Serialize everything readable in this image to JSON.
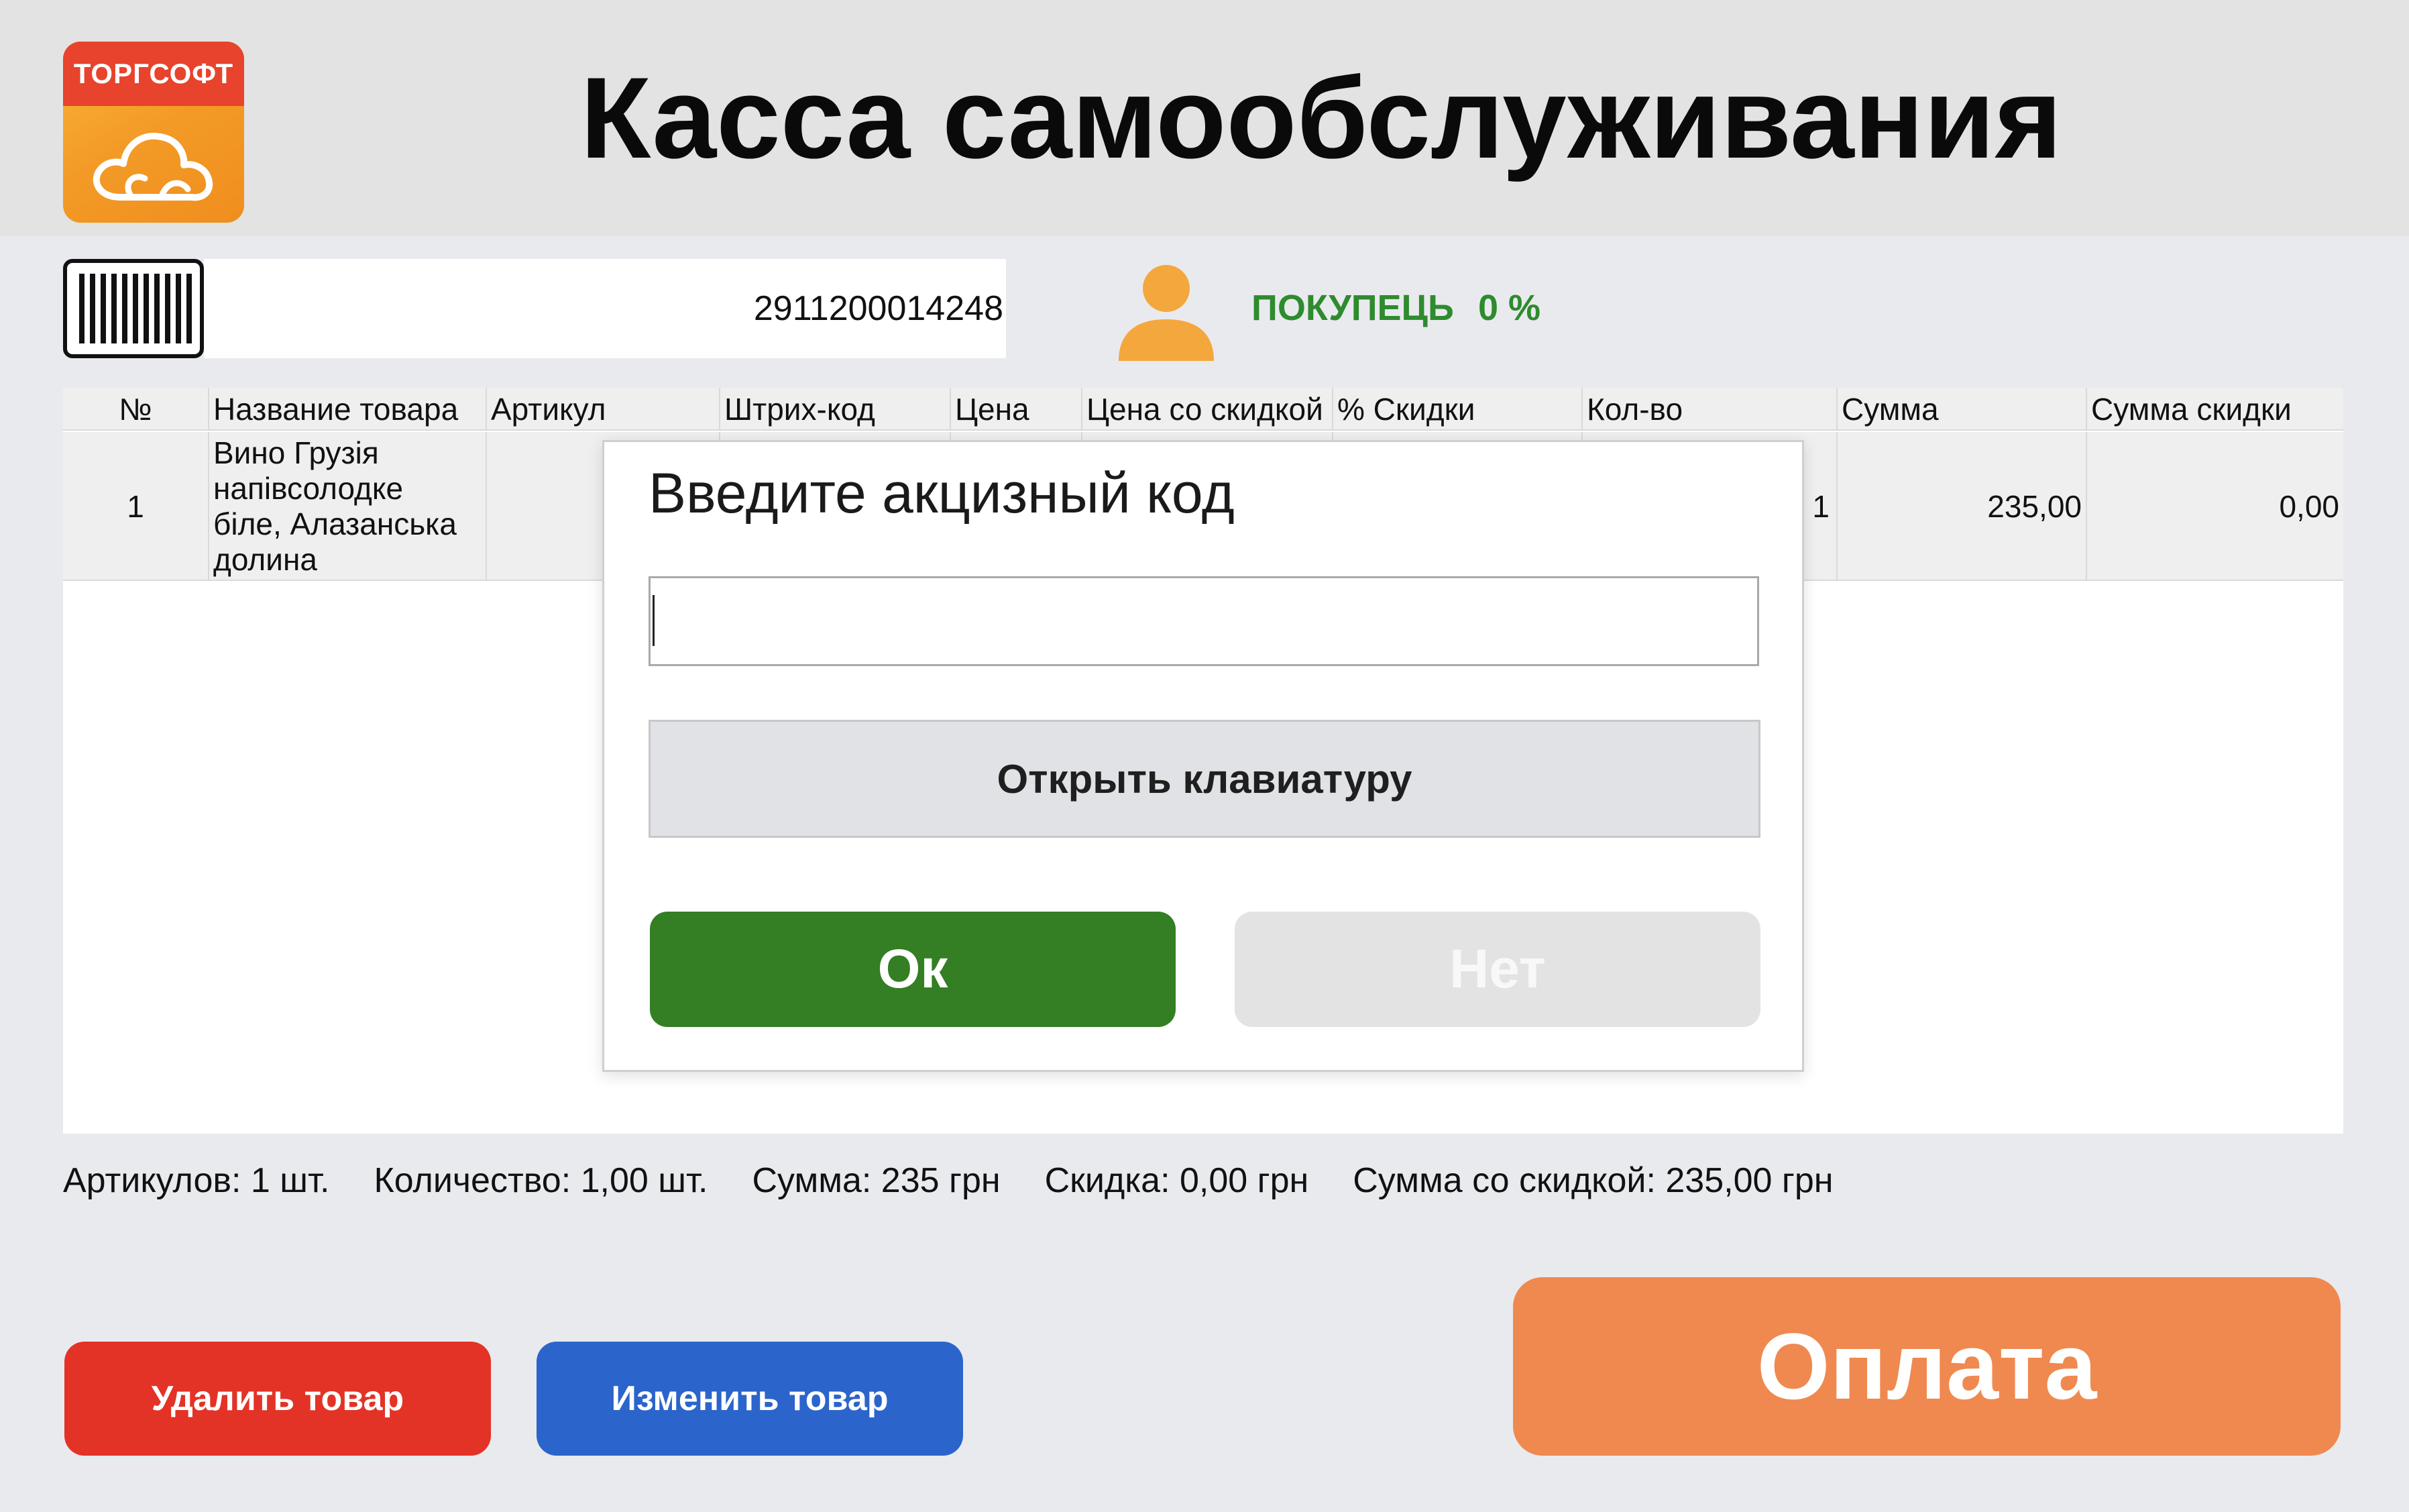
{
  "header": {
    "logo_text": "ТОРГСОФТ",
    "title": "Касса самообслуживания"
  },
  "scan": {
    "barcode_value": "2911200014248",
    "customer_label": "ПОКУПЕЦЬ",
    "customer_discount": "0 %"
  },
  "table": {
    "columns": [
      "№",
      "Название товара",
      "Артикул",
      "Штрих-код",
      "Цена",
      "Цена со скидкой",
      "% Скидки",
      "Кол-во",
      "Сумма",
      "Сумма скидки"
    ],
    "rows": [
      {
        "num": "1",
        "name_lines": [
          "Вино Грузія",
          "напівсолодке",
          "біле, Алазанська",
          "долина"
        ],
        "article": "",
        "barcode": "",
        "price": "",
        "price_discount": "",
        "discount_pct": "",
        "qty": "1",
        "sum": "235,00",
        "sum_discount": "0,00"
      }
    ]
  },
  "summary": {
    "articles": "Артикулов: 1 шт.",
    "quantity": "Количество: 1,00 шт.",
    "sum": "Сумма: 235 грн",
    "discount": "Скидка: 0,00 грн",
    "sum_discounted": "Сумма со скидкой: 235,00 грн"
  },
  "buttons": {
    "delete": "Удалить товар",
    "edit": "Изменить товар",
    "pay": "Оплата"
  },
  "modal": {
    "title": "Введите акцизный код",
    "input_value": "",
    "keyboard_button": "Открыть клавиатуру",
    "ok": "Ок",
    "no": "Нет"
  },
  "colors": {
    "header_bg": "#e3e3e3",
    "page_bg": "#e9eaee",
    "logo_red": "#e8432c",
    "logo_orange": "#f39a26",
    "customer_green": "#2e8b2e",
    "delete_red": "#e33326",
    "edit_blue": "#2b64cb",
    "pay_orange": "#ef894f",
    "ok_green": "#347e24",
    "no_gray": "#e3e3e3"
  },
  "icons": {
    "logo": "cloud-icon",
    "barcode": "barcode-icon",
    "customer": "person-icon"
  }
}
